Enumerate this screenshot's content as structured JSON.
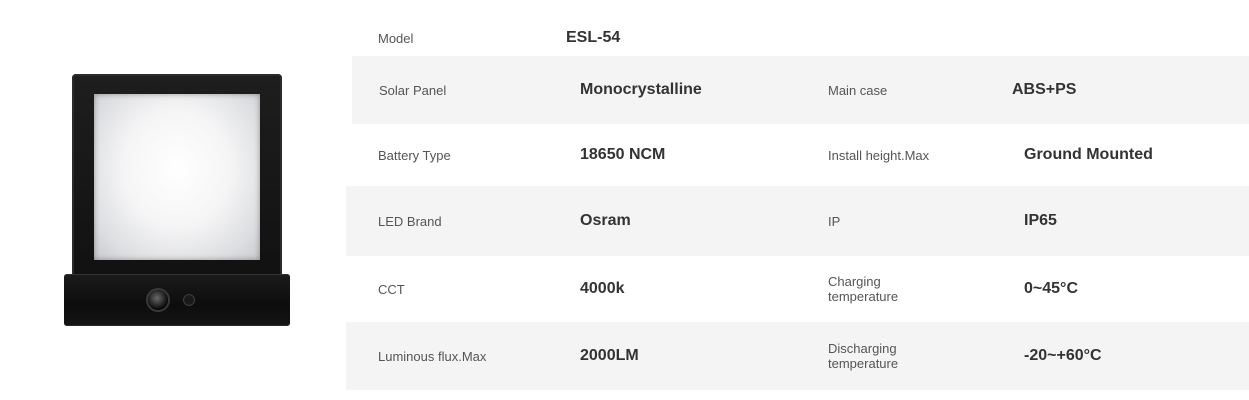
{
  "product": {
    "image_alt": "solar wall lamp"
  },
  "specs": {
    "model": {
      "label": "Model",
      "value": "ESL-54"
    },
    "rows": [
      {
        "label1": "Solar Panel",
        "value1": "Monocrystalline",
        "label2": "Main case",
        "value2": "ABS+PS"
      },
      {
        "label1": "Battery Type",
        "value1": "18650 NCM",
        "label2": "Install height.Max",
        "value2": "Ground Mounted"
      },
      {
        "label1": "LED Brand",
        "value1": "Osram",
        "label2": "IP",
        "value2": "IP65"
      },
      {
        "label1": "CCT",
        "value1": "4000k",
        "label2": "Charging temperature",
        "value2": "0~45°C"
      },
      {
        "label1": "Luminous flux.Max",
        "value1": "2000LM",
        "label2": "Discharging temperature",
        "value2": "-20~+60°C"
      }
    ]
  },
  "colors": {
    "row_shade": "#f4f4f4",
    "text": "#333333",
    "lamp_body": "#111111"
  }
}
